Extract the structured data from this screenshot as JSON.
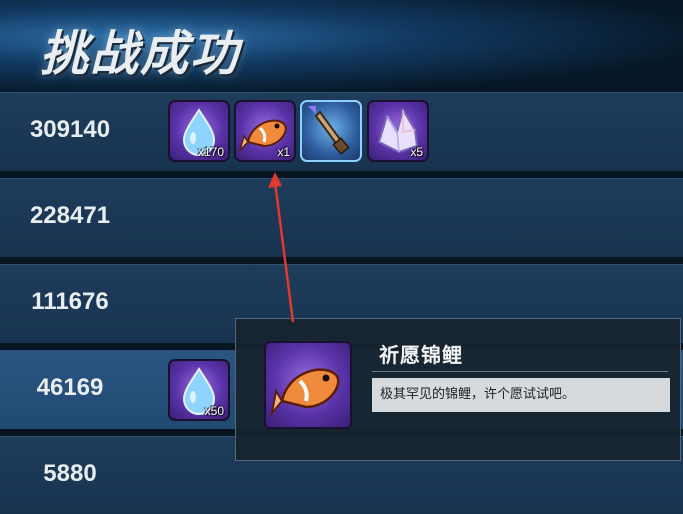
{
  "header": {
    "title": "挑战成功"
  },
  "rows": [
    {
      "score": "309140"
    },
    {
      "score": "228471"
    },
    {
      "score": "111676"
    },
    {
      "score": "46169"
    },
    {
      "score": "5880"
    }
  ],
  "rewards_row1": [
    {
      "icon": "water-drop-icon",
      "qty": "x170"
    },
    {
      "icon": "koi-fish-icon",
      "qty": "x1"
    },
    {
      "icon": "dagger-icon",
      "qty": ""
    },
    {
      "icon": "crystal-icon",
      "qty": "x5"
    }
  ],
  "rewards_row4": [
    {
      "icon": "water-drop-icon",
      "qty": "x50"
    }
  ],
  "tooltip": {
    "name": "祈愿锦鲤",
    "description": "极其罕见的锦鲤，许个愿试试吧。"
  },
  "colors": {
    "highlight_row": "#2a5581",
    "arrow": "#e0392e"
  }
}
